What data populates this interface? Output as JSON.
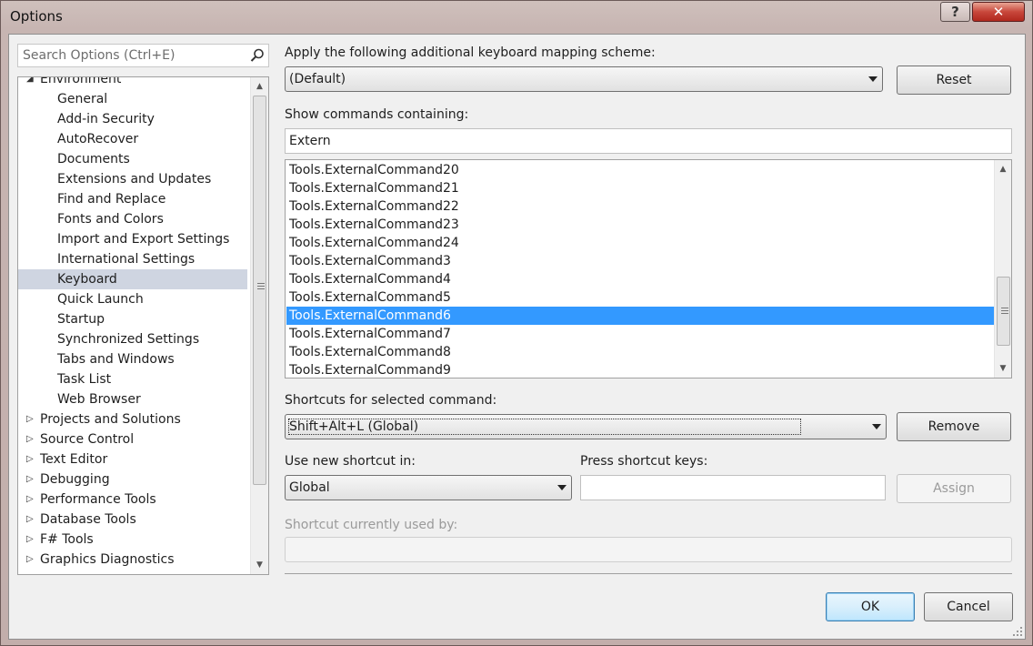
{
  "window": {
    "title": "Options",
    "help_label": "?",
    "close_label": "✕"
  },
  "search": {
    "placeholder": "Search Options (Ctrl+E)",
    "value": ""
  },
  "tree": {
    "items": [
      {
        "label": "Environment",
        "level": 0,
        "expander": "expanded",
        "selected": false
      },
      {
        "label": "General",
        "level": 1,
        "expander": "none",
        "selected": false
      },
      {
        "label": "Add-in Security",
        "level": 1,
        "expander": "none",
        "selected": false
      },
      {
        "label": "AutoRecover",
        "level": 1,
        "expander": "none",
        "selected": false
      },
      {
        "label": "Documents",
        "level": 1,
        "expander": "none",
        "selected": false
      },
      {
        "label": "Extensions and Updates",
        "level": 1,
        "expander": "none",
        "selected": false
      },
      {
        "label": "Find and Replace",
        "level": 1,
        "expander": "none",
        "selected": false
      },
      {
        "label": "Fonts and Colors",
        "level": 1,
        "expander": "none",
        "selected": false
      },
      {
        "label": "Import and Export Settings",
        "level": 1,
        "expander": "none",
        "selected": false
      },
      {
        "label": "International Settings",
        "level": 1,
        "expander": "none",
        "selected": false
      },
      {
        "label": "Keyboard",
        "level": 1,
        "expander": "none",
        "selected": true
      },
      {
        "label": "Quick Launch",
        "level": 1,
        "expander": "none",
        "selected": false
      },
      {
        "label": "Startup",
        "level": 1,
        "expander": "none",
        "selected": false
      },
      {
        "label": "Synchronized Settings",
        "level": 1,
        "expander": "none",
        "selected": false
      },
      {
        "label": "Tabs and Windows",
        "level": 1,
        "expander": "none",
        "selected": false
      },
      {
        "label": "Task List",
        "level": 1,
        "expander": "none",
        "selected": false
      },
      {
        "label": "Web Browser",
        "level": 1,
        "expander": "none",
        "selected": false
      },
      {
        "label": "Projects and Solutions",
        "level": 0,
        "expander": "collapsed",
        "selected": false
      },
      {
        "label": "Source Control",
        "level": 0,
        "expander": "collapsed",
        "selected": false
      },
      {
        "label": "Text Editor",
        "level": 0,
        "expander": "collapsed",
        "selected": false
      },
      {
        "label": "Debugging",
        "level": 0,
        "expander": "collapsed",
        "selected": false
      },
      {
        "label": "Performance Tools",
        "level": 0,
        "expander": "collapsed",
        "selected": false
      },
      {
        "label": "Database Tools",
        "level": 0,
        "expander": "collapsed",
        "selected": false
      },
      {
        "label": "F# Tools",
        "level": 0,
        "expander": "collapsed",
        "selected": false
      },
      {
        "label": "Graphics Diagnostics",
        "level": 0,
        "expander": "collapsed",
        "selected": false
      }
    ]
  },
  "mapping": {
    "label": "Apply the following additional keyboard mapping scheme:",
    "value": "(Default)",
    "reset_label": "Reset"
  },
  "show_commands": {
    "label": "Show commands containing:",
    "value": "Extern"
  },
  "commands": {
    "items": [
      "Tools.ExternalCommand20",
      "Tools.ExternalCommand21",
      "Tools.ExternalCommand22",
      "Tools.ExternalCommand23",
      "Tools.ExternalCommand24",
      "Tools.ExternalCommand3",
      "Tools.ExternalCommand4",
      "Tools.ExternalCommand5",
      "Tools.ExternalCommand6",
      "Tools.ExternalCommand7",
      "Tools.ExternalCommand8",
      "Tools.ExternalCommand9"
    ],
    "selected": "Tools.ExternalCommand6"
  },
  "shortcuts": {
    "label": "Shortcuts for selected command:",
    "value": "Shift+Alt+L (Global)",
    "remove_label": "Remove"
  },
  "new_shortcut": {
    "label": "Use new shortcut in:",
    "value": "Global"
  },
  "press_keys": {
    "label": "Press shortcut keys:",
    "value": "",
    "assign_label": "Assign"
  },
  "used_by": {
    "label": "Shortcut currently used by:",
    "value": ""
  },
  "footer": {
    "ok_label": "OK",
    "cancel_label": "Cancel"
  },
  "colors": {
    "selection": "#3399ff",
    "tree_selection": "#cfd5e1",
    "close_button": "#c8473b"
  }
}
